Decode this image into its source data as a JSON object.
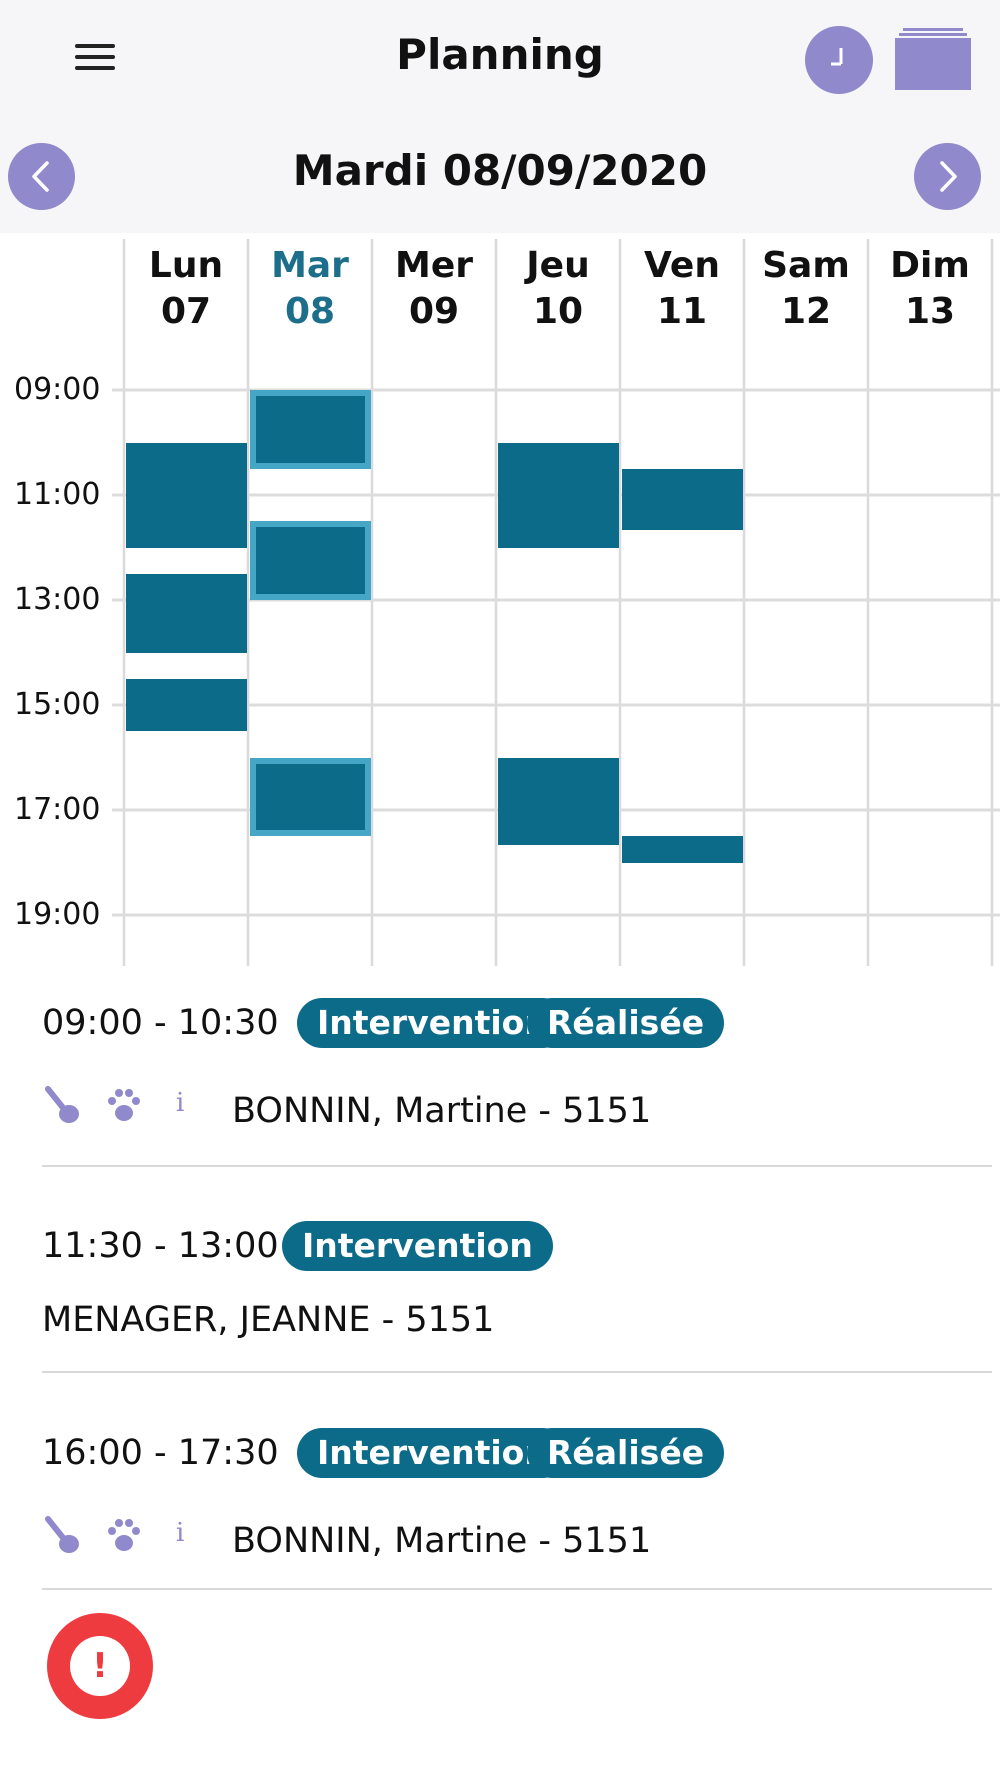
{
  "header": {
    "title": "Planning",
    "menu_icon": "hamburger-menu-icon",
    "clock_icon": "clock-icon",
    "calendar_icon": "calendar-icon",
    "date_title": "Mardi 08/09/2020",
    "accent_color": "#9089cb"
  },
  "week": {
    "days": [
      {
        "name": "Lun",
        "num": "07"
      },
      {
        "name": "Mar",
        "num": "08"
      },
      {
        "name": "Mer",
        "num": "09"
      },
      {
        "name": "Jeu",
        "num": "10"
      },
      {
        "name": "Ven",
        "num": "11"
      },
      {
        "name": "Sam",
        "num": "12"
      },
      {
        "name": "Dim",
        "num": "13"
      }
    ],
    "selected_day": "Mar",
    "hours": [
      "09:00",
      "11:00",
      "13:00",
      "15:00",
      "17:00",
      "19:00"
    ],
    "event_color": "#0c6b88",
    "selected_event_border": "#46a6c6",
    "events": [
      {
        "day": "Lun",
        "start": "10:00",
        "end": "12:00"
      },
      {
        "day": "Lun",
        "start": "12:30",
        "end": "14:00"
      },
      {
        "day": "Lun",
        "start": "14:30",
        "end": "15:30"
      },
      {
        "day": "Mar",
        "start": "09:00",
        "end": "10:30",
        "selected": true
      },
      {
        "day": "Mar",
        "start": "11:30",
        "end": "13:00",
        "selected": true
      },
      {
        "day": "Mar",
        "start": "16:00",
        "end": "17:30",
        "selected": true
      },
      {
        "day": "Jeu",
        "start": "10:00",
        "end": "12:00"
      },
      {
        "day": "Jeu",
        "start": "16:00",
        "end": "17:40"
      },
      {
        "day": "Ven",
        "start": "10:30",
        "end": "11:40"
      },
      {
        "day": "Ven",
        "start": "17:30",
        "end": "18:00"
      }
    ]
  },
  "slots": [
    {
      "time": "09:00 - 10:30",
      "badges": [
        "Intervention",
        "Réalisée"
      ],
      "icons": [
        "broom-icon",
        "paw-icon",
        "info-icon"
      ],
      "client": "BONNIN, Martine - 5151"
    },
    {
      "time": "11:30 - 13:00",
      "badges": [
        "Intervention"
      ],
      "icons": [],
      "client": "MENAGER, JEANNE - 5151"
    },
    {
      "time": "16:00 - 17:30",
      "badges": [
        "Intervention",
        "Réalisée"
      ],
      "icons": [
        "broom-icon",
        "paw-icon",
        "info-icon"
      ],
      "client": "BONNIN, Martine - 5151"
    }
  ],
  "alert_button": {
    "label": "!",
    "icon": "alert-icon",
    "color": "#ee3b3f"
  }
}
